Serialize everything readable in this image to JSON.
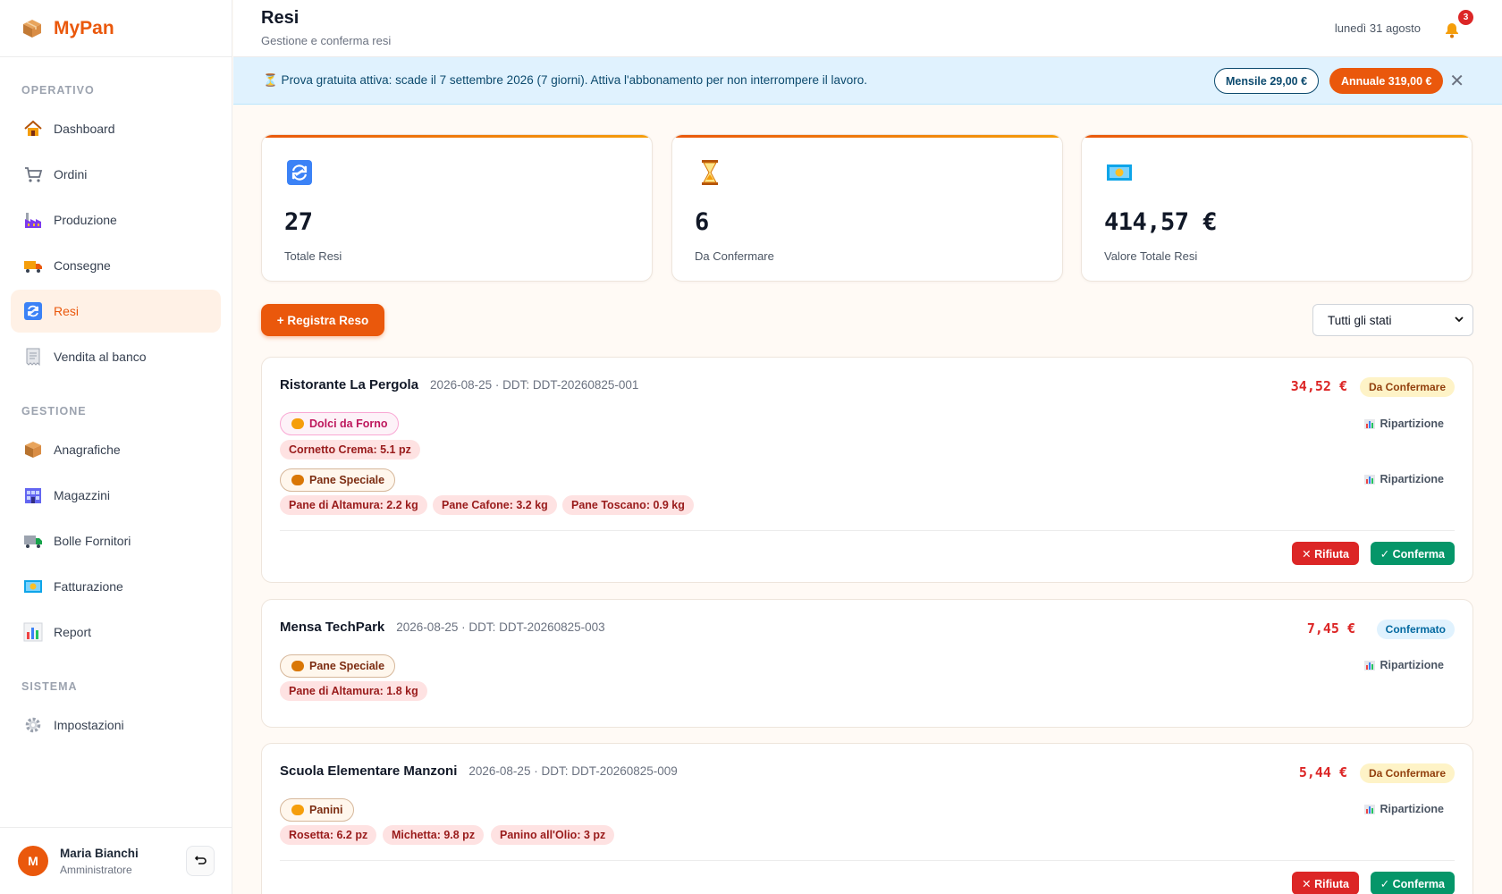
{
  "app": {
    "name": "MyPan"
  },
  "sidebar": {
    "sections": [
      {
        "title": "OPERATIVO",
        "items": [
          {
            "label": "Dashboard",
            "icon": "house-icon"
          },
          {
            "label": "Ordini",
            "icon": "cart-icon"
          },
          {
            "label": "Produzione",
            "icon": "factory-icon"
          },
          {
            "label": "Consegne",
            "icon": "truck-icon"
          },
          {
            "label": "Resi",
            "icon": "return-arrows-icon",
            "active": true
          },
          {
            "label": "Vendita al banco",
            "icon": "receipt-icon"
          }
        ]
      },
      {
        "title": "GESTIONE",
        "items": [
          {
            "label": "Anagrafiche",
            "icon": "box-icon"
          },
          {
            "label": "Magazzini",
            "icon": "warehouse-icon"
          },
          {
            "label": "Bolle Fornitori",
            "icon": "delivery-truck-icon"
          },
          {
            "label": "Fatturazione",
            "icon": "banknote-icon"
          },
          {
            "label": "Report",
            "icon": "bar-chart-icon"
          }
        ]
      },
      {
        "title": "SISTEMA",
        "items": [
          {
            "label": "Impostazioni",
            "icon": "gear-icon"
          }
        ]
      }
    ]
  },
  "user": {
    "initial": "M",
    "name": "Maria Bianchi",
    "role": "Amministratore"
  },
  "header": {
    "title": "Resi",
    "subtitle": "Gestione e conferma resi",
    "date": "lunedì 31 agosto",
    "notifications": "3"
  },
  "banner": {
    "text": "⏳ Prova gratuita attiva: scade il 7 settembre 2026 (7 giorni). Attiva l'abbonamento per non interrompere il lavoro.",
    "monthly": "Mensile 29,00 €",
    "annual": "Annuale 319,00 €"
  },
  "stats": [
    {
      "value": "27",
      "label": "Totale Resi",
      "icon": "return-arrows-icon"
    },
    {
      "value": "6",
      "label": "Da Confermare",
      "icon": "hourglass-icon"
    },
    {
      "value": "414,57 €",
      "label": "Valore Totale Resi",
      "icon": "banknote-icon"
    }
  ],
  "actions": {
    "register": "+ Registra Reso",
    "filter": "Tutti gli stati"
  },
  "returns": [
    {
      "customer": "Ristorante La Pergola",
      "meta": "2026-08-25 · DDT: DDT-20260825-001",
      "amount": "34,52 €",
      "status": "Da Confermare",
      "groups": [
        {
          "category": "Dolci da Forno",
          "split": "Ripartizione",
          "items": [
            "Cornetto Crema: 5.1 pz"
          ]
        },
        {
          "category": "Pane Speciale",
          "split": "Ripartizione",
          "items": [
            "Pane di Altamura: 2.2 kg",
            "Pane Cafone: 3.2 kg",
            "Pane Toscano: 0.9 kg"
          ]
        }
      ],
      "reject": "✕ Rifiuta",
      "confirm": "✓ Conferma"
    },
    {
      "customer": "Mensa TechPark",
      "meta": "2026-08-25 · DDT: DDT-20260825-003",
      "amount": "7,45 €",
      "status": "Confermato",
      "groups": [
        {
          "category": "Pane Speciale",
          "split": "Ripartizione",
          "items": [
            "Pane di Altamura: 1.8 kg"
          ]
        }
      ]
    },
    {
      "customer": "Scuola Elementare Manzoni",
      "meta": "2026-08-25 · DDT: DDT-20260825-009",
      "amount": "5,44 €",
      "status": "Da Confermare",
      "groups": [
        {
          "category": "Panini",
          "split": "Ripartizione",
          "items": [
            "Rosetta: 6.2 pz",
            "Michetta: 9.8 pz",
            "Panino all'Olio: 3 pz"
          ]
        }
      ],
      "reject": "✕ Rifiuta",
      "confirm": "✓ Conferma"
    }
  ],
  "colors": {
    "accent": "#ea580c",
    "danger": "#dc2626",
    "success": "#059669",
    "banner_bg": "#e0f2fe"
  }
}
